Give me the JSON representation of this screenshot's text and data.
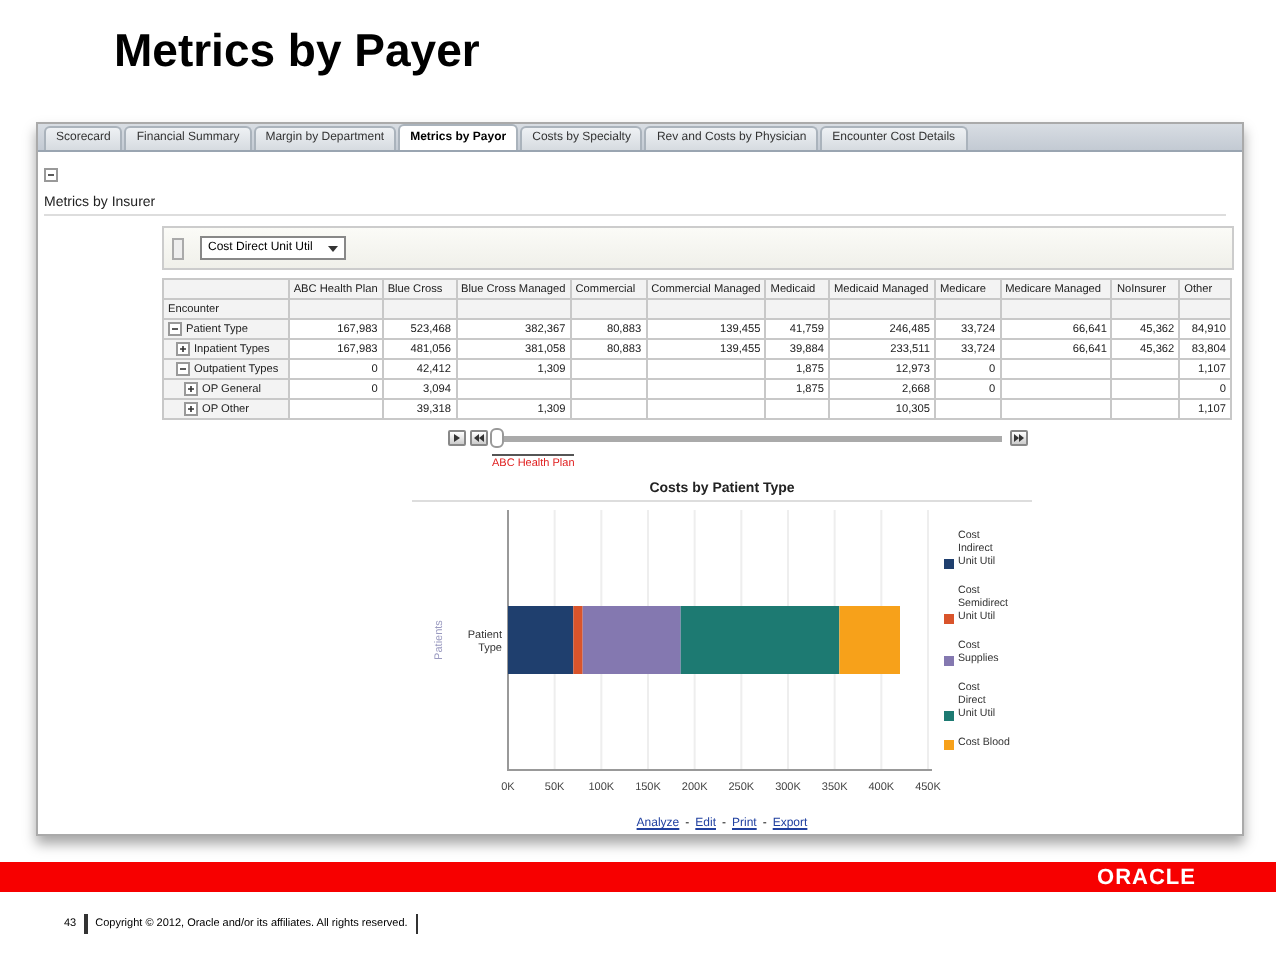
{
  "slide": {
    "title": "Metrics by Payer",
    "page_number": "43",
    "copyright": "Copyright © 2012, Oracle and/or its affiliates. All rights reserved.",
    "logo": "ORACLE"
  },
  "tabs": [
    {
      "label": "Scorecard",
      "selected": false
    },
    {
      "label": "Financial Summary",
      "selected": false
    },
    {
      "label": "Margin by Department",
      "selected": false
    },
    {
      "label": "Metrics by Payor",
      "selected": true
    },
    {
      "label": "Costs by Specialty",
      "selected": false
    },
    {
      "label": "Rev and Costs by Physician",
      "selected": false
    },
    {
      "label": "Encounter Cost Details",
      "selected": false
    }
  ],
  "section": {
    "title": "Metrics by Insurer",
    "expanded": true
  },
  "prompt": {
    "value": "Cost Direct Unit Util"
  },
  "table": {
    "columns": [
      "ABC Health Plan",
      "Blue Cross",
      "Blue Cross Managed",
      "Commercial",
      "Commercial Managed",
      "Medicaid",
      "Medicaid Managed",
      "Medicare",
      "Medicare Managed",
      "NoInsurer",
      "Other"
    ],
    "row_header": "Encounter",
    "rows": [
      {
        "label": "Patient Type",
        "expanded": true,
        "cells": [
          {
            "text": "167,983"
          },
          {
            "text": "523,468"
          },
          {
            "text": "382,367"
          },
          {
            "text": "80,883"
          },
          {
            "text": "139,455"
          },
          {
            "text": "41,759"
          },
          {
            "text": "246,485"
          },
          {
            "text": "33,724"
          },
          {
            "text": "66,641"
          },
          {
            "text": "45,362"
          },
          {
            "text": "84,910"
          }
        ],
        "children": [
          {
            "label": "Inpatient Types",
            "expanded": false,
            "cells": [
              {
                "text": "167,983"
              },
              {
                "text": "481,056"
              },
              {
                "text": "381,058"
              },
              {
                "text": "80,883"
              },
              {
                "text": "139,455"
              },
              {
                "text": "39,884"
              },
              {
                "text": "233,511"
              },
              {
                "text": "33,724"
              },
              {
                "text": "66,641"
              },
              {
                "text": "45,362"
              },
              {
                "text": "83,804"
              }
            ]
          },
          {
            "label": "Outpatient Types",
            "expanded": true,
            "cells": [
              {
                "text": "0"
              },
              {
                "text": "42,412"
              },
              {
                "text": "1,309"
              },
              {
                "empty": true
              },
              {
                "empty": true
              },
              {
                "text": "1,875"
              },
              {
                "text": "12,973"
              },
              {
                "text": "0"
              },
              {
                "empty": true
              },
              {
                "empty": true
              },
              {
                "text": "1,107"
              }
            ],
            "children": [
              {
                "label": "OP General",
                "expanded": false,
                "cells": [
                  {
                    "text": "0"
                  },
                  {
                    "text": "3,094"
                  },
                  {
                    "empty": true
                  },
                  {
                    "empty": true
                  },
                  {
                    "empty": true
                  },
                  {
                    "text": "1,875"
                  },
                  {
                    "text": "2,668"
                  },
                  {
                    "text": "0"
                  },
                  {
                    "empty": true
                  },
                  {
                    "empty": true
                  },
                  {
                    "text": "0"
                  }
                ]
              },
              {
                "label": "OP Other",
                "expanded": false,
                "cells": [
                  {
                    "empty": true
                  },
                  {
                    "text": "39,318"
                  },
                  {
                    "text": "1,309"
                  },
                  {
                    "empty": true
                  },
                  {
                    "empty": true
                  },
                  {
                    "empty": true
                  },
                  {
                    "text": "10,305"
                  },
                  {
                    "empty": true
                  },
                  {
                    "empty": true
                  },
                  {
                    "empty": true
                  },
                  {
                    "text": "1,107"
                  }
                ]
              }
            ]
          }
        ]
      }
    ]
  },
  "slider": {
    "level": 0,
    "label": "ABC Health Plan"
  },
  "chart": {
    "chart_data": {
      "type": "bar",
      "title": "Costs by Patient Type",
      "orientation": "horizontal",
      "stacked": true,
      "grid": true,
      "ylabel": "Patients",
      "categories": [
        "Patient Type"
      ],
      "series": [
        {
          "name": "Cost Indirect Unit Util",
          "color": "#1f3f6e",
          "values": [
            70000
          ]
        },
        {
          "name": "Cost Semidirect Unit Util",
          "color": "#d9542b",
          "values": [
            10000
          ]
        },
        {
          "name": "Cost Supplies",
          "color": "#8478b0",
          "values": [
            105000
          ]
        },
        {
          "name": "Cost Direct Unit Util",
          "color": "#1d7a72",
          "values": [
            170000
          ]
        },
        {
          "name": "Cost Blood",
          "color": "#f7a11a",
          "values": [
            65000
          ]
        }
      ],
      "xlim": [
        0,
        450000
      ],
      "xticks": [
        {
          "value": 0,
          "label": "0K"
        },
        {
          "value": 50000,
          "label": "50K"
        },
        {
          "value": 100000,
          "label": "100K"
        },
        {
          "value": 150000,
          "label": "150K"
        },
        {
          "value": 200000,
          "label": "200K"
        },
        {
          "value": 250000,
          "label": "250K"
        },
        {
          "value": 300000,
          "label": "300K"
        },
        {
          "value": 350000,
          "label": "350K"
        },
        {
          "value": 400000,
          "label": "400K"
        },
        {
          "value": 450000,
          "label": "450K"
        }
      ]
    },
    "links": [
      "Analyze",
      "Edit",
      "Print",
      "Export"
    ],
    "link_separator": "-"
  }
}
